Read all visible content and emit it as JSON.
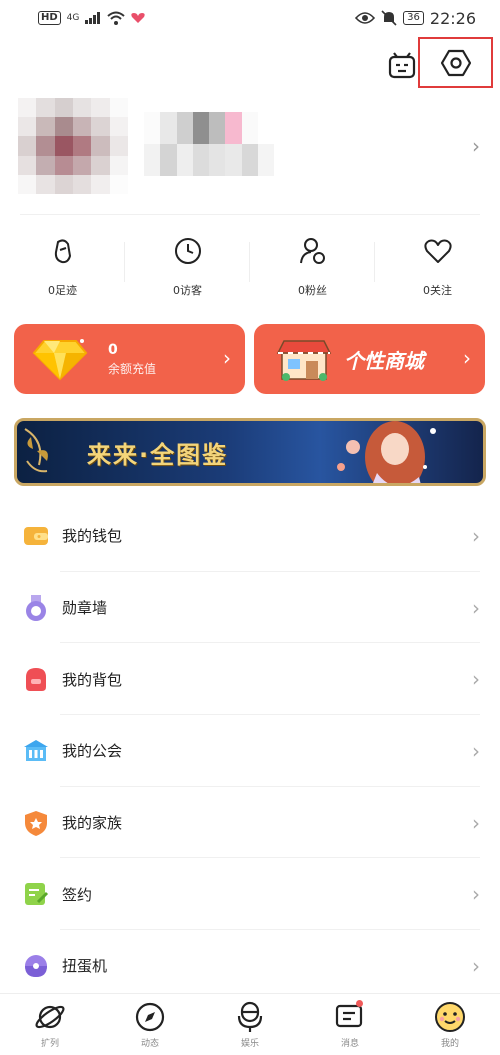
{
  "status_bar": {
    "network": "HD",
    "signal": "4G",
    "battery": "36",
    "time": "22:26"
  },
  "header": {
    "robot_icon": "robot-icon",
    "settings_icon": "settings-hexagon-icon"
  },
  "stats": [
    {
      "label": "0足迹",
      "icon": "footprint-icon"
    },
    {
      "label": "0访客",
      "icon": "clock-icon"
    },
    {
      "label": "0粉丝",
      "icon": "fans-icon"
    },
    {
      "label": "0关注",
      "icon": "heart-icon"
    }
  ],
  "cards": {
    "balance_value": "0",
    "balance_label": "余额充值",
    "shop_label": "个性商城"
  },
  "banner": {
    "text": "来来·全图鉴"
  },
  "menu": [
    {
      "label": "我的钱包",
      "icon": "wallet-icon"
    },
    {
      "label": "勋章墙",
      "icon": "medal-icon"
    },
    {
      "label": "我的背包",
      "icon": "backpack-icon"
    },
    {
      "label": "我的公会",
      "icon": "guild-icon"
    },
    {
      "label": "我的家族",
      "icon": "family-shield-icon"
    },
    {
      "label": "签约",
      "icon": "contract-icon"
    },
    {
      "label": "扭蛋机",
      "icon": "gacha-icon"
    }
  ],
  "bottom_nav": [
    {
      "label": "扩列",
      "icon": "planet-icon"
    },
    {
      "label": "动态",
      "icon": "compass-icon"
    },
    {
      "label": "娱乐",
      "icon": "microphone-icon"
    },
    {
      "label": "消息",
      "icon": "message-icon"
    },
    {
      "label": "我的",
      "icon": "smiley-icon"
    }
  ],
  "colors": {
    "accent": "#f2624a",
    "highlight_box": "#e03b3b",
    "nav_badge": "#f05a5a"
  }
}
